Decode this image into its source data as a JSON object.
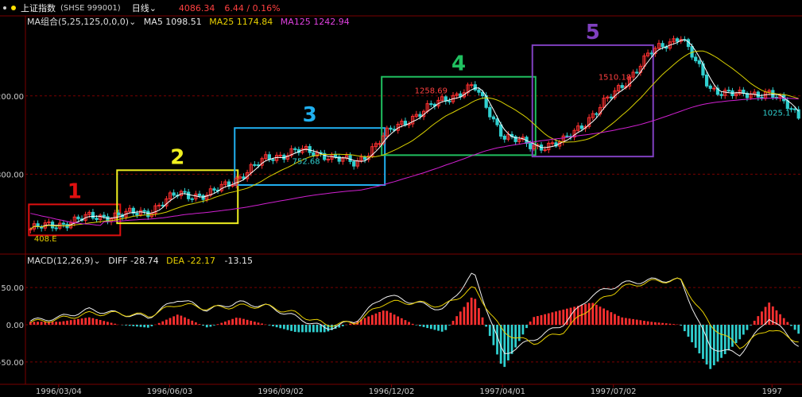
{
  "header": {
    "instrument": "上证指数",
    "code": "(SHSE 999001)",
    "period": "日线",
    "price": "4086.34",
    "change": "6.44 / 0.16%"
  },
  "ma_legend": {
    "title": "MA组合(5,25,125,0,0,0)",
    "ma5": "MA5 1098.51",
    "ma25": "MA25 1174.84",
    "ma125": "MA125 1242.94"
  },
  "macd_legend": {
    "title": "MACD(12,26,9)",
    "diff": "DIFF -28.74",
    "dea": "DEA -22.17",
    "macd": "-13.15"
  },
  "colors": {
    "up": "#ff3030",
    "down": "#30d0d0",
    "ma5": "#ffffff",
    "ma25": "#d8d000",
    "ma125": "#d020d0",
    "box1": "#e01010",
    "box2": "#f0f020",
    "box3": "#20b0f0",
    "box4": "#20c060",
    "box5": "#8040c0",
    "grid": "#7a0000"
  },
  "chart_data": [
    {
      "type": "candlestick",
      "x_dates": [
        "1996/01/22",
        "1996/02/10",
        "1996/03/04",
        "1996/03/25",
        "1996/04/15",
        "1996/05/06",
        "1996/06/03",
        "1996/06/24",
        "1996/07/15",
        "1996/08/05",
        "1996/08/26",
        "1996/09/16",
        "1996/10/07",
        "1996/10/28",
        "1996/11/18",
        "1996/12/09",
        "1996/12/30",
        "1997/01/20",
        "1997/02/10",
        "1997/03/03",
        "1997/03/24",
        "1997/04/14",
        "1997/05/05",
        "1997/05/26",
        "1997/06/16",
        "1997/07/07",
        "1997/07/28"
      ],
      "close": [
        520,
        545,
        580,
        590,
        610,
        700,
        690,
        780,
        880,
        920,
        900,
        850,
        1000,
        1100,
        1180,
        1250,
        1000,
        940,
        960,
        1100,
        1250,
        1420,
        1510,
        1240,
        1200,
        1220,
        1100
      ],
      "tick_labels_x": [
        "1996/03/04",
        "1996/06/03",
        "1996/09/02",
        "1996/12/02",
        "1997/04/01",
        "1997/07/02",
        "1997"
      ],
      "tick_labels_y": [
        "800.00",
        "1200.00"
      ],
      "annotations": [
        {
          "text": "408.E",
          "color": "yellow"
        },
        {
          "text": "752.68",
          "color": "cyan"
        },
        {
          "text": "1258.69",
          "color": "red"
        },
        {
          "text": "1510.18",
          "color": "red"
        },
        {
          "text": "1025.1",
          "color": "cyan"
        }
      ],
      "boxes": [
        {
          "label": "1",
          "from": "1996/01/22",
          "to": "1996/03/25"
        },
        {
          "label": "2",
          "from": "1996/03/25",
          "to": "1996/06/24"
        },
        {
          "label": "3",
          "from": "1996/06/24",
          "to": "1996/10/07"
        },
        {
          "label": "4",
          "from": "1996/10/07",
          "to": "1997/01/20"
        },
        {
          "label": "5",
          "from": "1997/01/20",
          "to": "1997/04/14"
        }
      ]
    },
    {
      "type": "macd",
      "tick_labels_y": [
        "50.00",
        "0.00",
        "-50.00"
      ],
      "diff": [
        5,
        10,
        20,
        15,
        10,
        35,
        20,
        30,
        25,
        10,
        -5,
        5,
        40,
        30,
        20,
        70,
        -40,
        -20,
        0,
        40,
        55,
        60,
        60,
        -30,
        -40,
        10,
        -28
      ],
      "dea": [
        3,
        8,
        15,
        15,
        12,
        28,
        22,
        25,
        25,
        15,
        0,
        3,
        30,
        30,
        25,
        50,
        -10,
        -25,
        -10,
        25,
        50,
        58,
        60,
        0,
        -30,
        -5,
        -22
      ],
      "hist": [
        4,
        4,
        10,
        0,
        -4,
        14,
        -4,
        10,
        0,
        -10,
        -10,
        4,
        20,
        0,
        -10,
        40,
        -60,
        10,
        20,
        30,
        10,
        4,
        0,
        -60,
        -20,
        30,
        -13
      ]
    }
  ]
}
